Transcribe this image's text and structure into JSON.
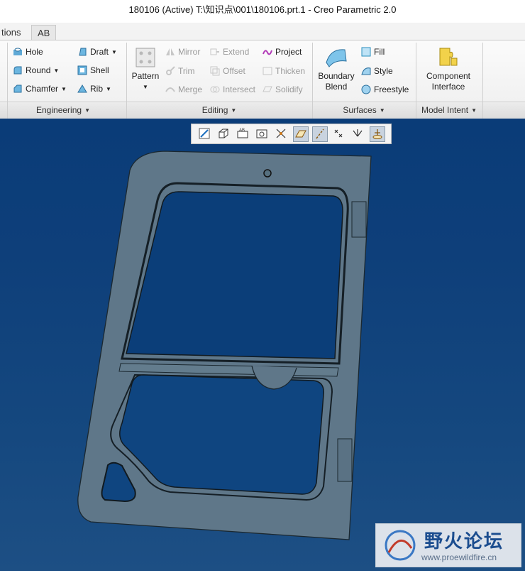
{
  "window": {
    "title": "180106 (Active) T:\\知识点\\001\\180106.prt.1 - Creo Parametric 2.0"
  },
  "tabs": [
    {
      "label": "tions"
    },
    {
      "label": "AB"
    }
  ],
  "ribbon": {
    "engineering": {
      "label": "Engineering",
      "hole": "Hole",
      "round": "Round",
      "chamfer": "Chamfer",
      "draft": "Draft",
      "shell": "Shell",
      "rib": "Rib"
    },
    "editing": {
      "label": "Editing",
      "pattern": "Pattern",
      "mirror": "Mirror",
      "trim": "Trim",
      "merge": "Merge",
      "extend": "Extend",
      "offset": "Offset",
      "intersect": "Intersect",
      "project": "Project",
      "thicken": "Thicken",
      "solidify": "Solidify"
    },
    "surfaces": {
      "label": "Surfaces",
      "boundary_line1": "Boundary",
      "boundary_line2": "Blend",
      "fill": "Fill",
      "style": "Style",
      "freestyle": "Freestyle"
    },
    "model_intent": {
      "label": "Model Intent",
      "component_line1": "Component",
      "component_line2": "Interface"
    }
  },
  "view_toolbar": {
    "buttons": [
      {
        "icon": "refit-icon",
        "active": false
      },
      {
        "icon": "saved-orientations-icon",
        "active": false
      },
      {
        "icon": "annotation-display-icon",
        "active": false
      },
      {
        "icon": "named-views-icon",
        "active": false
      },
      {
        "icon": "datum-display-icon",
        "active": false
      },
      {
        "icon": "plane-display-icon",
        "active": true
      },
      {
        "icon": "axis-display-icon",
        "active": true
      },
      {
        "icon": "point-display-icon",
        "active": false
      },
      {
        "icon": "csys-display-icon",
        "active": false
      },
      {
        "icon": "spin-center-icon",
        "active": true
      }
    ]
  },
  "model": {
    "name": "180106",
    "face_color": "#5f7789",
    "edge_color": "#1b2830"
  },
  "watermark": {
    "text_cn": "野火论坛",
    "url": "www.proewildfire.cn"
  },
  "colors": {
    "viewport_top": "#0a3c78",
    "viewport_bottom": "#1d4f84",
    "accent": "#1b4d8f"
  }
}
